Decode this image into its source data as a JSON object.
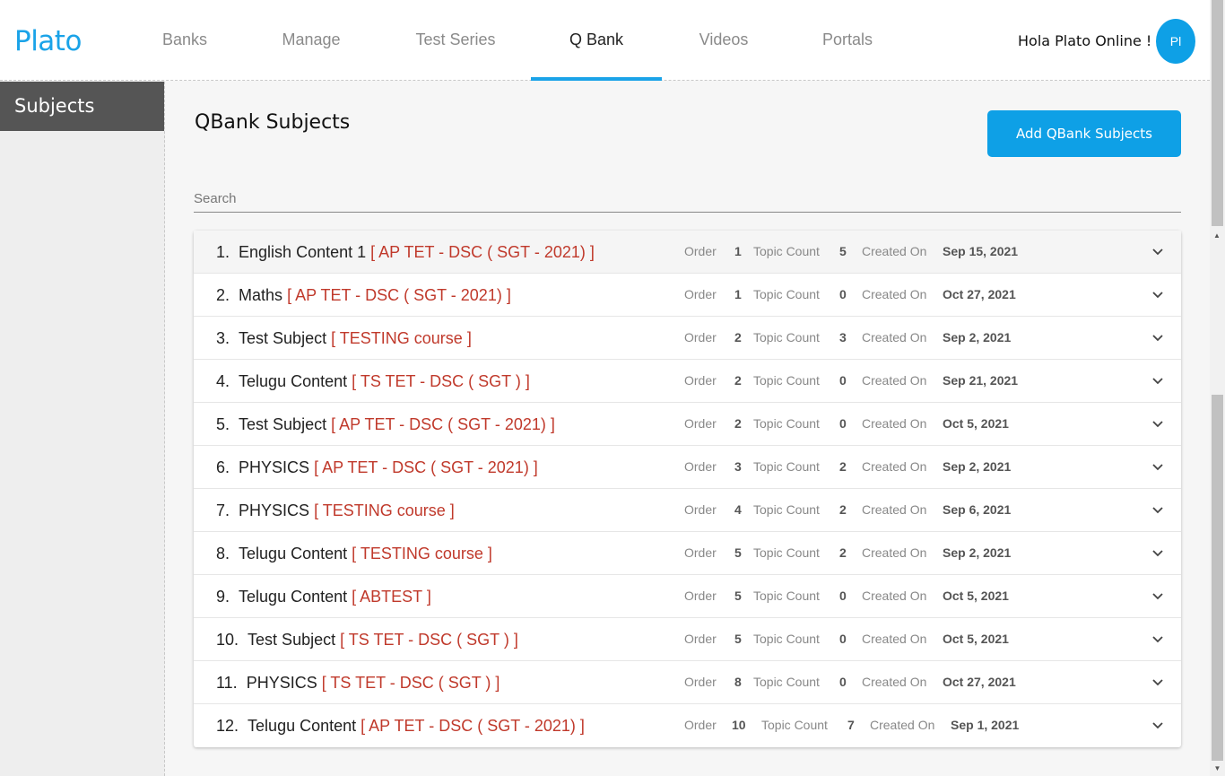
{
  "header": {
    "logo": "Plato",
    "nav": [
      "Banks",
      "Manage",
      "Test Series",
      "Q Bank",
      "Videos",
      "Portals"
    ],
    "active_nav": "Q Bank",
    "greeting": "Hola Plato Online !",
    "avatar_initials": "Pl"
  },
  "sidebar": {
    "items": [
      {
        "label": "Subjects"
      }
    ]
  },
  "main": {
    "title": "QBank Subjects",
    "add_button": "Add QBank Subjects",
    "search_placeholder": "Search",
    "labels": {
      "order": "Order",
      "topic_count": "Topic Count",
      "created_on": "Created On"
    },
    "subjects": [
      {
        "num": "1.",
        "name": "English Content 1",
        "course": "[ AP TET - DSC ( SGT - 2021) ]",
        "order": "1",
        "topic_count": "5",
        "created_on": "Sep 15, 2021"
      },
      {
        "num": "2.",
        "name": "Maths",
        "course": "[ AP TET - DSC ( SGT - 2021) ]",
        "order": "1",
        "topic_count": "0",
        "created_on": "Oct 27, 2021"
      },
      {
        "num": "3.",
        "name": "Test Subject",
        "course": "[ TESTING course ]",
        "order": "2",
        "topic_count": "3",
        "created_on": "Sep 2, 2021"
      },
      {
        "num": "4.",
        "name": "Telugu Content",
        "course": "[ TS TET - DSC ( SGT ) ]",
        "order": "2",
        "topic_count": "0",
        "created_on": "Sep 21, 2021"
      },
      {
        "num": "5.",
        "name": "Test Subject",
        "course": "[ AP TET - DSC ( SGT - 2021) ]",
        "order": "2",
        "topic_count": "0",
        "created_on": "Oct 5, 2021"
      },
      {
        "num": "6.",
        "name": "PHYSICS ",
        "course": "[ AP TET - DSC ( SGT - 2021) ]",
        "order": "3",
        "topic_count": "2",
        "created_on": "Sep 2, 2021"
      },
      {
        "num": "7.",
        "name": "PHYSICS ",
        "course": "[ TESTING course ]",
        "order": "4",
        "topic_count": "2",
        "created_on": "Sep 6, 2021"
      },
      {
        "num": "8.",
        "name": "Telugu Content",
        "course": "[ TESTING course ]",
        "order": "5",
        "topic_count": "2",
        "created_on": "Sep 2, 2021"
      },
      {
        "num": "9.",
        "name": "Telugu Content",
        "course": "[ ABTEST ]",
        "order": "5",
        "topic_count": "0",
        "created_on": "Oct 5, 2021"
      },
      {
        "num": "10.",
        "name": "Test Subject",
        "course": "[ TS TET - DSC ( SGT ) ]",
        "order": "5",
        "topic_count": "0",
        "created_on": "Oct 5, 2021"
      },
      {
        "num": "11.",
        "name": "PHYSICS ",
        "course": "[ TS TET - DSC ( SGT ) ]",
        "order": "8",
        "topic_count": "0",
        "created_on": "Oct 27, 2021"
      },
      {
        "num": "12.",
        "name": "Telugu Content",
        "course": "[ AP TET - DSC ( SGT - 2021) ]",
        "order": "10",
        "topic_count": "7",
        "created_on": "Sep 1, 2021"
      }
    ]
  },
  "colors": {
    "accent": "#0ea0e6",
    "course_text": "#c0392b",
    "sidebar_active": "#555555"
  },
  "icons": {
    "row_toggle": "chevron-down-icon"
  }
}
